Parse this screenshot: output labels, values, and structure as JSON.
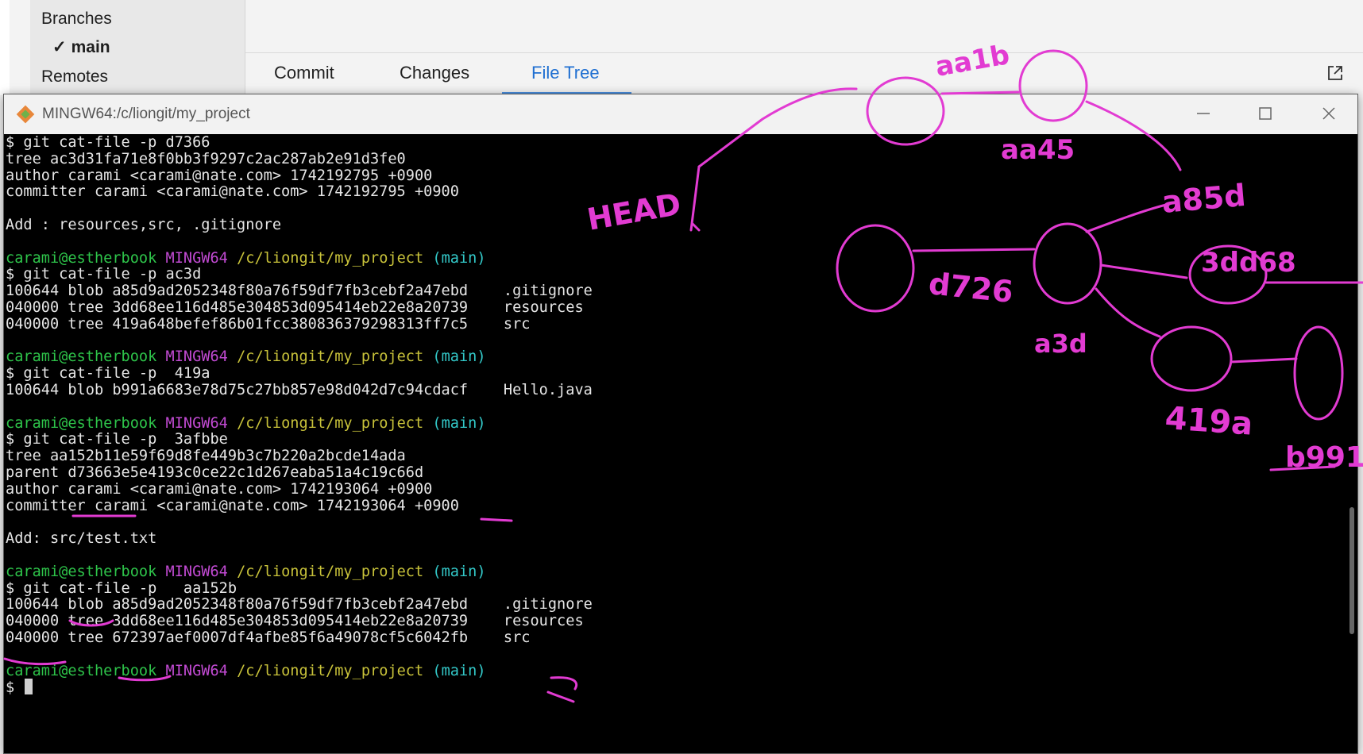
{
  "background_app": {
    "sidebar": {
      "branches_label": "Branches",
      "branch_current": "main",
      "remotes_label": "Remotes"
    },
    "tabs": [
      {
        "label": "Commit"
      },
      {
        "label": "Changes"
      },
      {
        "label": "File Tree",
        "active": true
      }
    ]
  },
  "terminal": {
    "title": "MINGW64:/c/liongit/my_project",
    "prompt": {
      "user": "carami@estherbook",
      "system": "MINGW64",
      "path": "/c/liongit/my_project",
      "branch": "(main)"
    },
    "lines": [
      "$ git cat-file -p d7366",
      "tree ac3d31fa71e8f0bb3f9297c2ac287ab2e91d3fe0",
      "author carami <carami@nate.com> 1742192795 +0900",
      "committer carami <carami@nate.com> 1742192795 +0900",
      "",
      "Add : resources,src, .gitignore",
      "",
      "PROMPT",
      "$ git cat-file -p ac3d",
      "100644 blob a85d9ad2052348f80a76f59df7fb3cebf2a47ebd    .gitignore",
      "040000 tree 3dd68ee116d485e304853d095414eb22e8a20739    resources",
      "040000 tree 419a648befef86b01fcc380836379298313ff7c5    src",
      "",
      "PROMPT",
      "$ git cat-file -p  419a",
      "100644 blob b991a6683e78d75c27bb857e98d042d7c94cdacf    Hello.java",
      "",
      "PROMPT",
      "$ git cat-file -p  3afbbe",
      "tree aa152b11e59f69d8fe449b3c7b220a2bcde14ada",
      "parent d73663e5e4193c0ce22c1d267eaba51a4c19c66d",
      "author carami <carami@nate.com> 1742193064 +0900",
      "committer carami <carami@nate.com> 1742193064 +0900",
      "",
      "Add: src/test.txt",
      "",
      "PROMPT",
      "$ git cat-file -p   aa152b",
      "100644 blob a85d9ad2052348f80a76f59df7fb3cebf2a47ebd    .gitignore",
      "040000 tree 3dd68ee116d485e304853d095414eb22e8a20739    resources",
      "040000 tree 672397aef0007df4afbe85f6a49078cf5c6042fb    src",
      "",
      "PROMPT",
      "$ "
    ]
  },
  "annotations": {
    "labels": [
      "aa1b",
      "aa45",
      "HEAD",
      "a85d",
      "d726",
      "3dd68",
      "a3d",
      "419a",
      "b991"
    ],
    "color": "#e23bd2"
  }
}
